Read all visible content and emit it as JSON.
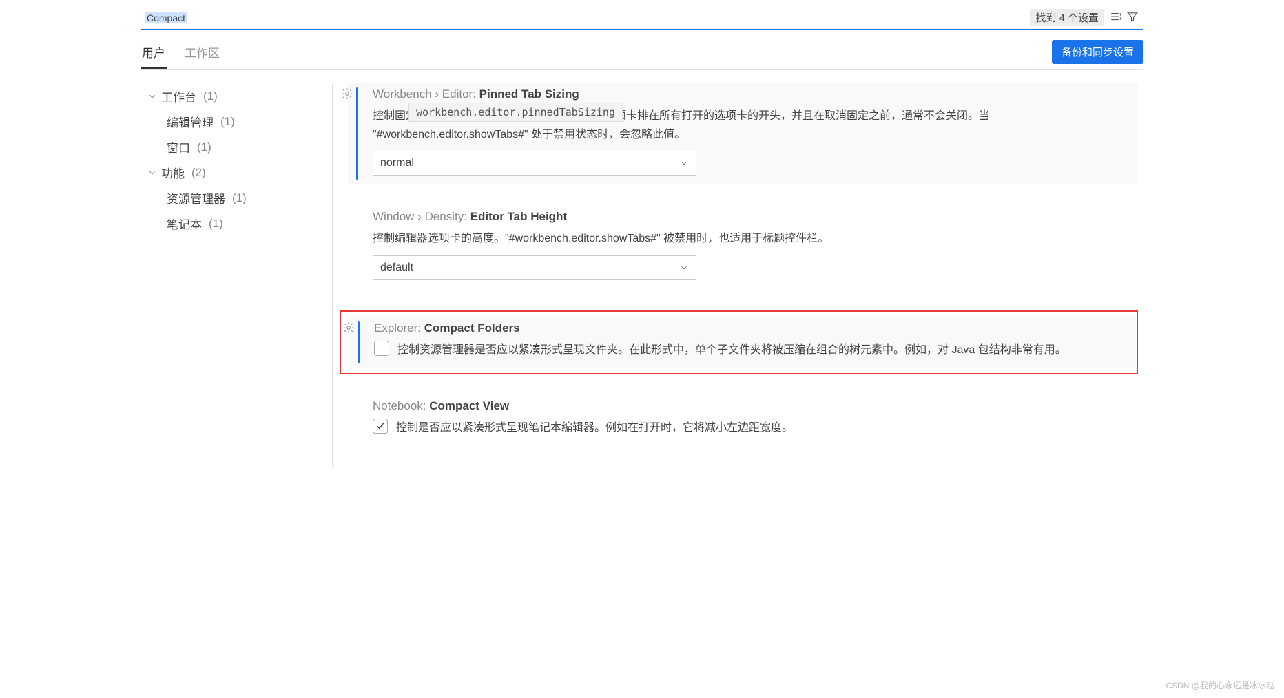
{
  "search": {
    "value": "Compact",
    "result_count": "找到 4 个设置"
  },
  "tabs": {
    "user": "用户",
    "workspace": "工作区"
  },
  "backup_button": "备份和同步设置",
  "sidebar": {
    "workbench": {
      "label": "工作台",
      "count": "(1)"
    },
    "editor_mgmt": {
      "label": "编辑管理",
      "count": "(1)"
    },
    "window": {
      "label": "窗口",
      "count": "(1)"
    },
    "features": {
      "label": "功能",
      "count": "(2)"
    },
    "explorer": {
      "label": "资源管理器",
      "count": "(1)"
    },
    "notebook": {
      "label": "笔记本",
      "count": "(1)"
    }
  },
  "settings": {
    "pinned_tab": {
      "scope": "Workbench › Editor: ",
      "name": "Pinned Tab Sizing",
      "tooltip": "workbench.editor.pinnedTabSizing",
      "desc": "控制固定时……………………………………………项卡排在所有打开的选项卡的开头，并且在取消固定之前，通常不会关闭。当 \"#workbench.editor.showTabs#\" 处于禁用状态时，会忽略此值。",
      "value": "normal"
    },
    "tab_height": {
      "scope": "Window › Density: ",
      "name": "Editor Tab Height",
      "desc": "控制编辑器选项卡的高度。\"#workbench.editor.showTabs#\" 被禁用时，也适用于标题控件栏。",
      "value": "default"
    },
    "compact_folders": {
      "scope": "Explorer: ",
      "name": "Compact Folders",
      "desc": "控制资源管理器是否应以紧凑形式呈现文件夹。在此形式中，单个子文件夹将被压缩在组合的树元素中。例如，对 Java 包结构非常有用。"
    },
    "compact_view": {
      "scope": "Notebook: ",
      "name": "Compact View",
      "desc": "控制是否应以紧凑形式呈现笔记本编辑器。例如在打开时，它将减小左边距宽度。"
    }
  },
  "watermark": "CSDN @我的心永远是冰冰哒"
}
